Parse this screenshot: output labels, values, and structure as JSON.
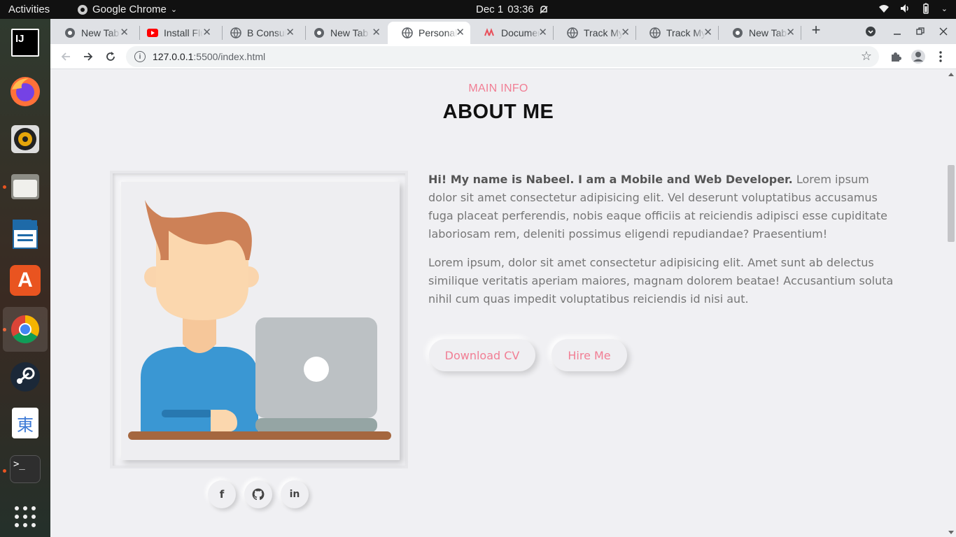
{
  "topbar": {
    "activities": "Activities",
    "app": "Google Chrome",
    "date": "Dec 1",
    "time": "03:36"
  },
  "dock": [
    {
      "name": "intellij-idea-icon",
      "label": "IJ"
    },
    {
      "name": "firefox-icon"
    },
    {
      "name": "rhythmbox-icon"
    },
    {
      "name": "files-icon"
    },
    {
      "name": "libreoffice-writer-icon"
    },
    {
      "name": "ubuntu-software-icon",
      "label": "A"
    },
    {
      "name": "google-chrome-icon"
    },
    {
      "name": "steam-icon"
    },
    {
      "name": "input-method-icon",
      "label": "東"
    },
    {
      "name": "terminal-icon",
      "label": ">_"
    },
    {
      "name": "show-applications-icon"
    }
  ],
  "tabs": [
    {
      "title": "New Tab",
      "icon": "chrome"
    },
    {
      "title": "Install Flutter",
      "icon": "youtube"
    },
    {
      "title": "B Consult",
      "icon": "globe"
    },
    {
      "title": "New Tab",
      "icon": "chrome"
    },
    {
      "title": "Personal",
      "icon": "globe",
      "active": true
    },
    {
      "title": "Documentation",
      "icon": "doc"
    },
    {
      "title": "Track My",
      "icon": "globe"
    },
    {
      "title": "Track My",
      "icon": "globe"
    },
    {
      "title": "New Tab",
      "icon": "chrome"
    }
  ],
  "address": {
    "host": "127.0.0.1",
    "path": ":5500/index.html"
  },
  "page": {
    "subtitle": "MAIN INFO",
    "heading": "ABOUT ME",
    "intro_bold": "Hi! My name is Nabeel. I am a Mobile and Web Developer.",
    "intro_rest": " Lorem ipsum dolor sit amet consectetur adipisicing elit. Vel deserunt voluptatibus accusamus fuga placeat perferendis, nobis eaque officiis at reiciendis adipisci esse cupiditate laboriosam rem, deleniti possimus eligendi repudiandae? Praesentium!",
    "paragraph2": "Lorem ipsum, dolor sit amet consectetur adipisicing elit. Amet sunt ab delectus similique veritatis aperiam maiores, magnam dolorem beatae! Accusantium soluta nihil cum quas impedit voluptatibus reiciendis id nisi aut.",
    "download_cv": "Download CV",
    "hire_me": "Hire Me",
    "social": [
      {
        "name": "facebook-icon",
        "glyph": "f"
      },
      {
        "name": "github-icon"
      },
      {
        "name": "linkedin-icon",
        "glyph": "in"
      }
    ]
  },
  "colors": {
    "accent": "#f17e94",
    "background": "#f0f0f3"
  }
}
